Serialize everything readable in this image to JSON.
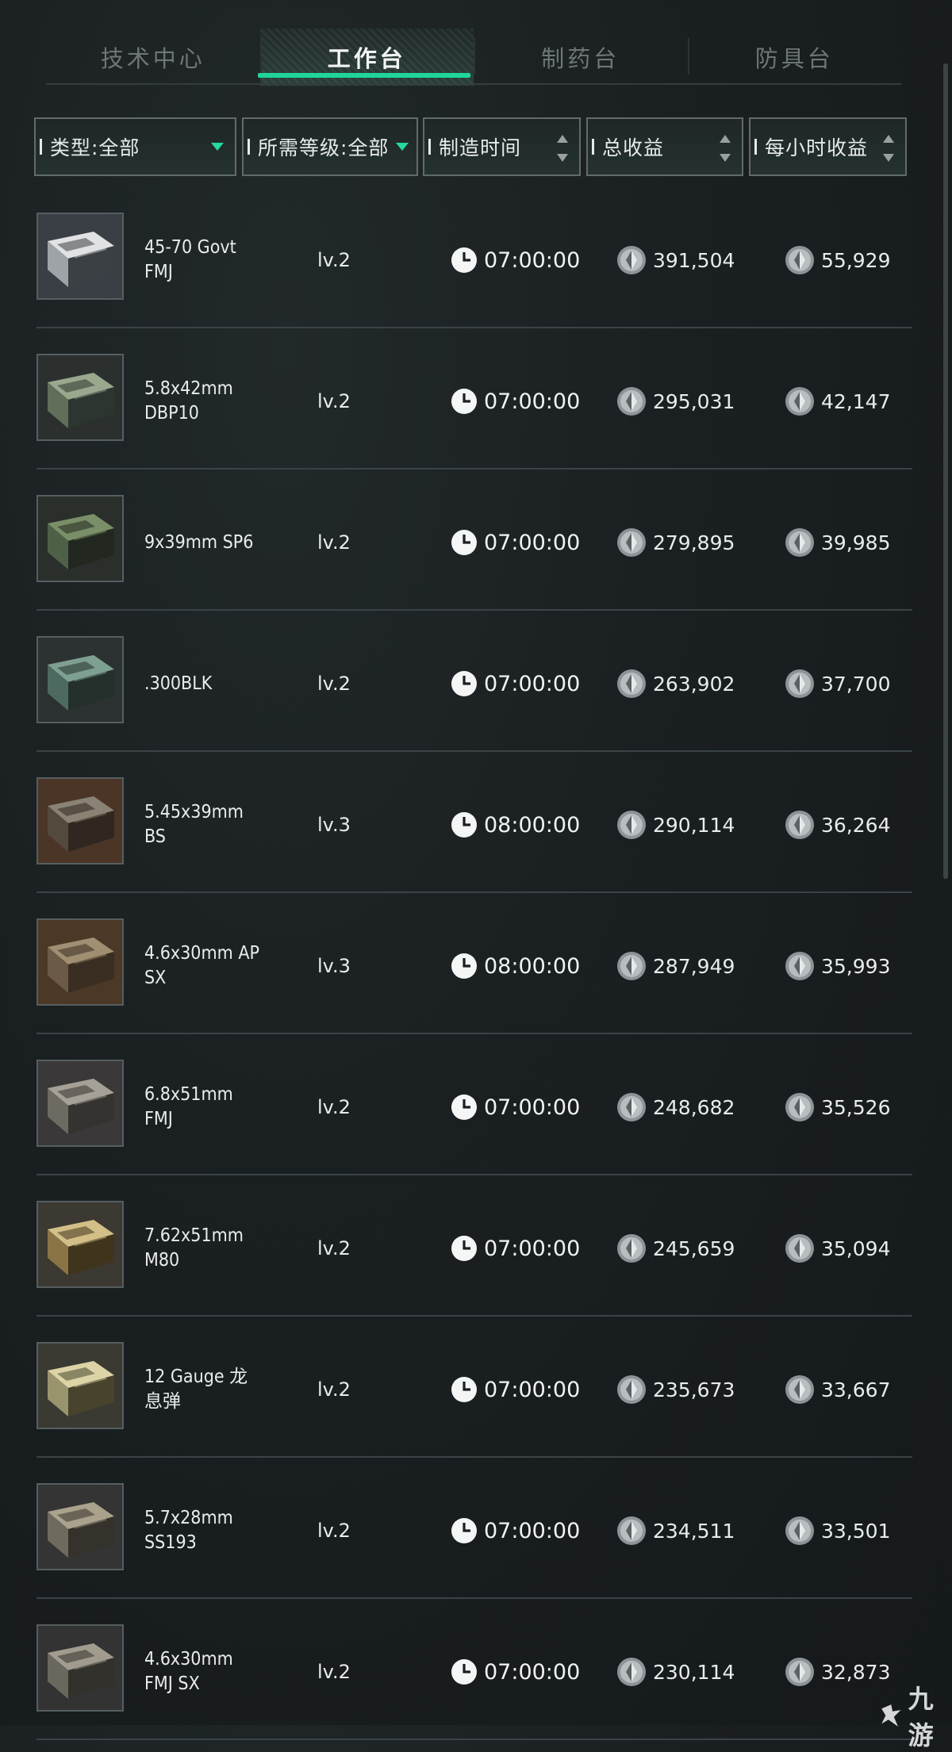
{
  "tabs": [
    {
      "label": "技术中心",
      "active": false
    },
    {
      "label": "工作台",
      "active": true
    },
    {
      "label": "制药台",
      "active": false
    },
    {
      "label": "防具台",
      "active": false
    }
  ],
  "filters": {
    "type": "类型:全部",
    "level": "所需等级:全部",
    "craft_time": "制造时间",
    "total_profit": "总收益",
    "hourly_profit": "每小时收益"
  },
  "colors": {
    "accent": "#1fd59a",
    "background": "#1a1f21",
    "separator": "#3a4345"
  },
  "rows": [
    {
      "name": "45-70 Govt\nFMJ",
      "level": "lv.2",
      "time": "07:00:00",
      "total": "391,504",
      "hourly": "55,929",
      "icon": "ammo-box-icon"
    },
    {
      "name": "5.8x42mm\nDBP10",
      "level": "lv.2",
      "time": "07:00:00",
      "total": "295,031",
      "hourly": "42,147",
      "icon": "ammo-box-icon"
    },
    {
      "name": "9x39mm SP6",
      "level": "lv.2",
      "time": "07:00:00",
      "total": "279,895",
      "hourly": "39,985",
      "icon": "ammo-box-icon"
    },
    {
      "name": ".300BLK",
      "level": "lv.2",
      "time": "07:00:00",
      "total": "263,902",
      "hourly": "37,700",
      "icon": "ammo-box-icon"
    },
    {
      "name": "5.45x39mm\nBS",
      "level": "lv.3",
      "time": "08:00:00",
      "total": "290,114",
      "hourly": "36,264",
      "icon": "ammo-box-icon"
    },
    {
      "name": "4.6x30mm AP\nSX",
      "level": "lv.3",
      "time": "08:00:00",
      "total": "287,949",
      "hourly": "35,993",
      "icon": "ammo-box-icon"
    },
    {
      "name": "6.8x51mm\nFMJ",
      "level": "lv.2",
      "time": "07:00:00",
      "total": "248,682",
      "hourly": "35,526",
      "icon": "ammo-box-icon"
    },
    {
      "name": "7.62x51mm\nM80",
      "level": "lv.2",
      "time": "07:00:00",
      "total": "245,659",
      "hourly": "35,094",
      "icon": "ammo-box-icon"
    },
    {
      "name": "12 Gauge 龙\n息弹",
      "level": "lv.2",
      "time": "07:00:00",
      "total": "235,673",
      "hourly": "33,667",
      "icon": "ammo-box-icon"
    },
    {
      "name": "5.7x28mm\nSS193",
      "level": "lv.2",
      "time": "07:00:00",
      "total": "234,511",
      "hourly": "33,501",
      "icon": "ammo-box-icon"
    },
    {
      "name": "4.6x30mm\nFMJ SX",
      "level": "lv.2",
      "time": "07:00:00",
      "total": "230,114",
      "hourly": "32,873",
      "icon": "ammo-box-icon"
    }
  ],
  "watermark": "九游"
}
